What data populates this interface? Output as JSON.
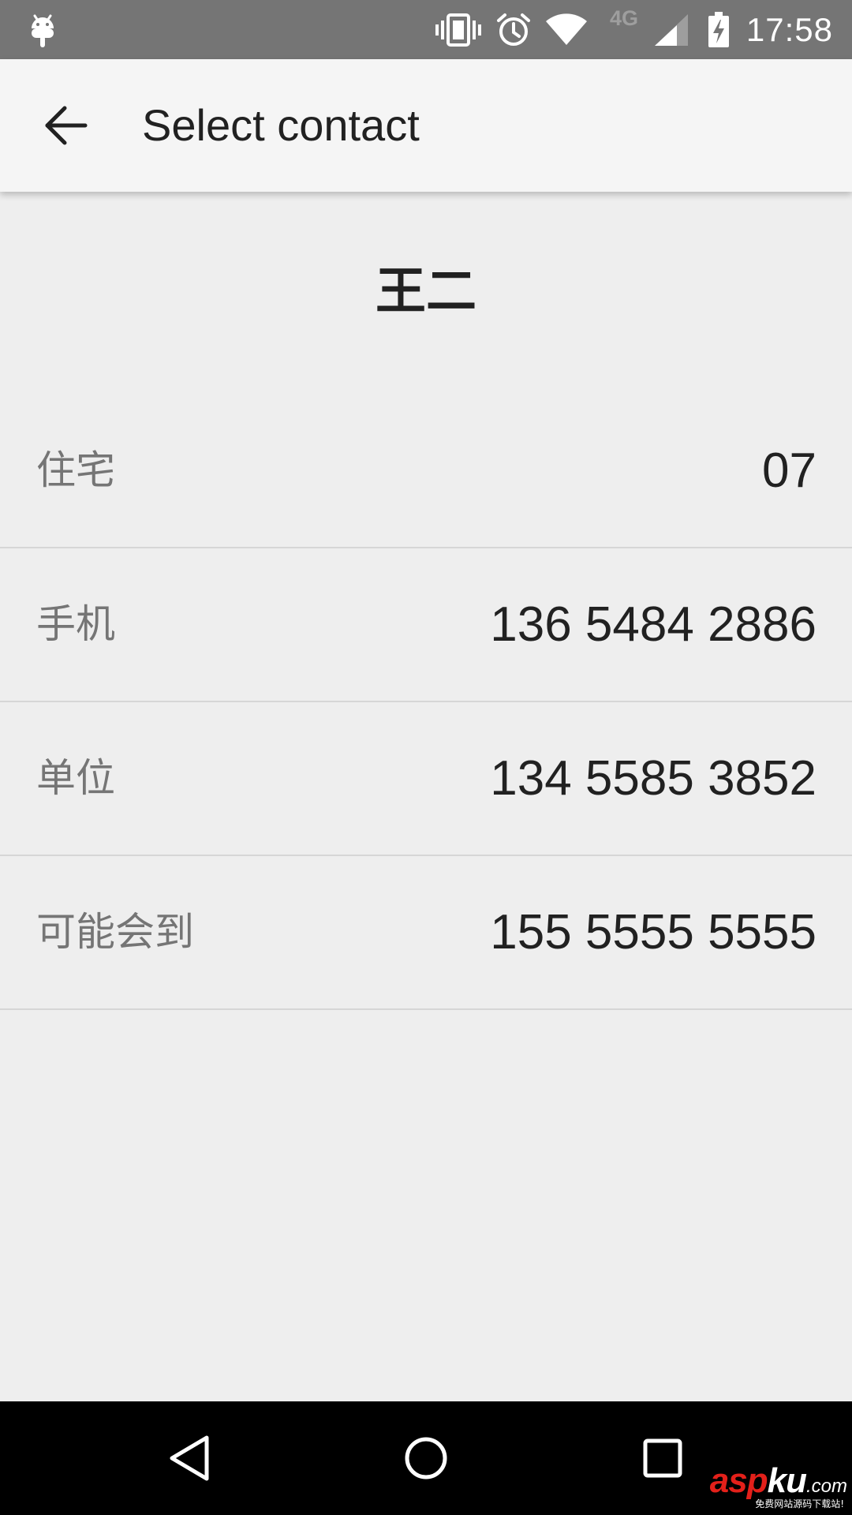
{
  "status_bar": {
    "time": "17:58",
    "network_type": "4G",
    "icons": [
      "android-debug-icon",
      "vibrate-icon",
      "alarm-icon",
      "wifi-icon",
      "cell-signal-icon",
      "battery-charging-icon"
    ]
  },
  "app_bar": {
    "title": "Select contact",
    "back_icon": "arrow-back-icon"
  },
  "contact": {
    "name": "王二",
    "phones": [
      {
        "label": "住宅",
        "number": "07"
      },
      {
        "label": "手机",
        "number": "136 5484 2886"
      },
      {
        "label": "单位",
        "number": "134 5585 3852"
      },
      {
        "label": "可能会到",
        "number": "155 5555 5555"
      }
    ]
  },
  "nav_bar": {
    "icons": [
      "back-triangle-icon",
      "home-circle-icon",
      "recents-square-icon"
    ]
  },
  "watermark": {
    "brand_red": "asp",
    "brand_white": "ku",
    "suffix": ".com",
    "tagline": "免费网站源码下载站!"
  },
  "colors": {
    "status_bar": "#757575",
    "app_bar": "#f5f5f5",
    "background": "#eeeeee",
    "primary_text": "#212121",
    "secondary_text": "#757575",
    "divider": "#d6d6d6",
    "nav_bar": "#000000",
    "watermark_red": "#e3201a"
  }
}
